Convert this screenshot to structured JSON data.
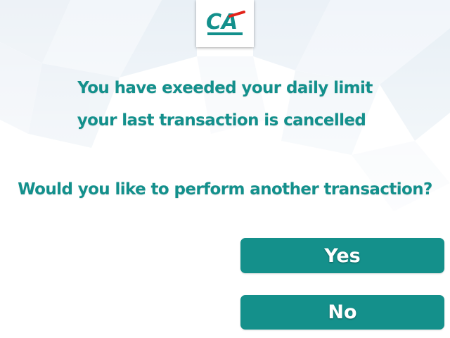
{
  "bank": {
    "logo_text": "CA",
    "brand_color": "#13908c",
    "accent_color": "#e2231a"
  },
  "message": {
    "line1": "You have exeeded your daily limit",
    "line2": "your last transaction is cancelled",
    "question": "Would you like to perform another transaction?"
  },
  "buttons": {
    "yes_label": "Yes",
    "no_label": "No"
  }
}
